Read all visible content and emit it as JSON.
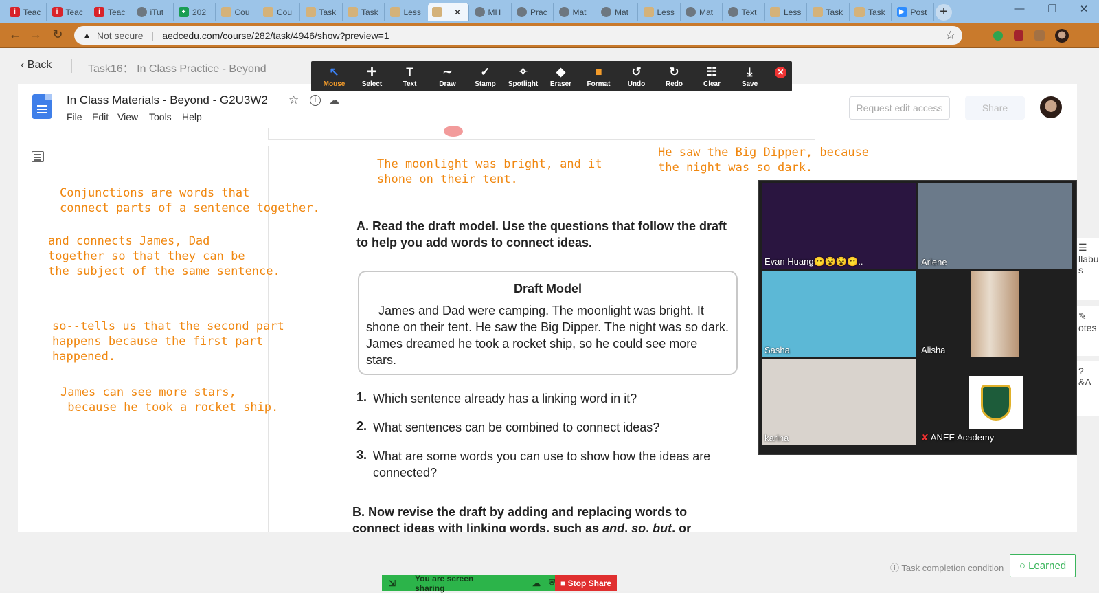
{
  "browser": {
    "tabs": [
      {
        "label": "Teac",
        "favicon": "i-red"
      },
      {
        "label": "Teac",
        "favicon": "i-red"
      },
      {
        "label": "Teac",
        "favicon": "i-red"
      },
      {
        "label": "iTut",
        "favicon": "globe"
      },
      {
        "label": "202",
        "favicon": "plus-green"
      },
      {
        "label": "Cou",
        "favicon": "doc-gold"
      },
      {
        "label": "Cou",
        "favicon": "doc-gold"
      },
      {
        "label": "Task",
        "favicon": "doc-gold"
      },
      {
        "label": "Task",
        "favicon": "doc-gold"
      },
      {
        "label": "Less",
        "favicon": "doc-gold"
      },
      {
        "label": "",
        "favicon": "doc-gold",
        "active": true
      },
      {
        "label": "MH",
        "favicon": "globe"
      },
      {
        "label": "Prac",
        "favicon": "globe"
      },
      {
        "label": "Mat",
        "favicon": "globe"
      },
      {
        "label": "Mat",
        "favicon": "globe"
      },
      {
        "label": "Less",
        "favicon": "doc-gold"
      },
      {
        "label": "Mat",
        "favicon": "globe"
      },
      {
        "label": "Text",
        "favicon": "globe"
      },
      {
        "label": "Less",
        "favicon": "doc-gold"
      },
      {
        "label": "Task",
        "favicon": "doc-gold"
      },
      {
        "label": "Task",
        "favicon": "doc-gold"
      },
      {
        "label": "Post",
        "favicon": "zoom"
      }
    ],
    "security_label": "Not secure",
    "url": "aedcedu.com/course/282/task/4946/show?preview=1"
  },
  "course": {
    "back_label": "Back",
    "breadcrumb": "Task16： In Class Practice - Beyond"
  },
  "gdoc": {
    "title": "In Class Materials - Beyond - G2U3W2",
    "menu": [
      "File",
      "Edit",
      "View",
      "Tools",
      "Help"
    ],
    "request_edit": "Request edit access",
    "share": "Share"
  },
  "annotations": {
    "top_center": "The moonlight was bright, and it\nshone on their tent.",
    "top_right": "He saw the Big Dipper, because\nthe night was so dark.",
    "left_1": "Conjunctions are words that\nconnect parts of a sentence together.",
    "left_2": "and connects James, Dad\ntogether so that they can be\nthe subject of the same sentence.",
    "left_3": "so--tells us that the second part\nhappens because the first part\nhappened.",
    "left_4": "James can see more stars,\n because he took a rocket ship."
  },
  "worksheet": {
    "section_a": "A. Read the draft model. Use the questions that follow the draft to help you add words to connect ideas.",
    "draft_title": "Draft Model",
    "draft_text": "James and Dad were camping. The moonlight was bright. It shone on their tent. He saw the Big Dipper. The night was so dark. James dreamed he took a rocket ship, so he could see more stars.",
    "questions": [
      {
        "num": "1.",
        "text": "Which sentence already has a linking word in it?"
      },
      {
        "num": "2.",
        "text": "What sentences can be combined to connect ideas?"
      },
      {
        "num": "3.",
        "text": "What are some words you can use to show how the ideas are connected?"
      }
    ],
    "section_b_prefix": "B. Now revise the draft by adding and replacing words to connect ideas with linking words, such as ",
    "section_b_words": [
      "and",
      "so",
      "but"
    ],
    "section_b_suffix": ", or"
  },
  "annotate_toolbar": {
    "tools": [
      {
        "label": "Mouse",
        "icon": "mouse-pointer-icon",
        "glyph": "↖",
        "selected": true
      },
      {
        "label": "Select",
        "icon": "move-icon",
        "glyph": "✛"
      },
      {
        "label": "Text",
        "icon": "text-icon",
        "glyph": "T"
      },
      {
        "label": "Draw",
        "icon": "draw-icon",
        "glyph": "∼"
      },
      {
        "label": "Stamp",
        "icon": "stamp-icon",
        "glyph": "✓"
      },
      {
        "label": "Spotlight",
        "icon": "spotlight-icon",
        "glyph": "✧"
      },
      {
        "label": "Eraser",
        "icon": "eraser-icon",
        "glyph": "◆"
      },
      {
        "label": "Format",
        "icon": "format-icon",
        "glyph": "■"
      },
      {
        "label": "Undo",
        "icon": "undo-icon",
        "glyph": "↺"
      },
      {
        "label": "Redo",
        "icon": "redo-icon",
        "glyph": "↻"
      },
      {
        "label": "Clear",
        "icon": "trash-icon",
        "glyph": "☷"
      },
      {
        "label": "Save",
        "icon": "save-icon",
        "glyph": "⤓"
      }
    ],
    "format_color": "#f39b2a"
  },
  "participants": [
    {
      "name": "Evan Huang😶😵😵😶..",
      "bg": "#2a1540"
    },
    {
      "name": "Arlene",
      "bg": "#6b7a8a"
    },
    {
      "name": "Sasha",
      "bg": "#5cb8d6"
    },
    {
      "name": "Alisha",
      "bg": "#1f1f1f"
    },
    {
      "name": "karina",
      "bg": "#d9d3cd"
    },
    {
      "name": "ANEE Academy",
      "bg": "#1f1f1f",
      "muted": true
    }
  ],
  "side_panel": [
    "llabu\ns",
    "otes",
    "&A"
  ],
  "footer": {
    "task_condition": "Task completion condition",
    "learned": "Learned",
    "sharing_status": "You are screen sharing",
    "stop_share": "Stop Share"
  },
  "colors": {
    "annotation": "#f0870f",
    "address_bar": "#c97a2c",
    "tab_strip": "#9cc4e8",
    "learned": "#3bb55c",
    "stop_share": "#e02f2f"
  }
}
